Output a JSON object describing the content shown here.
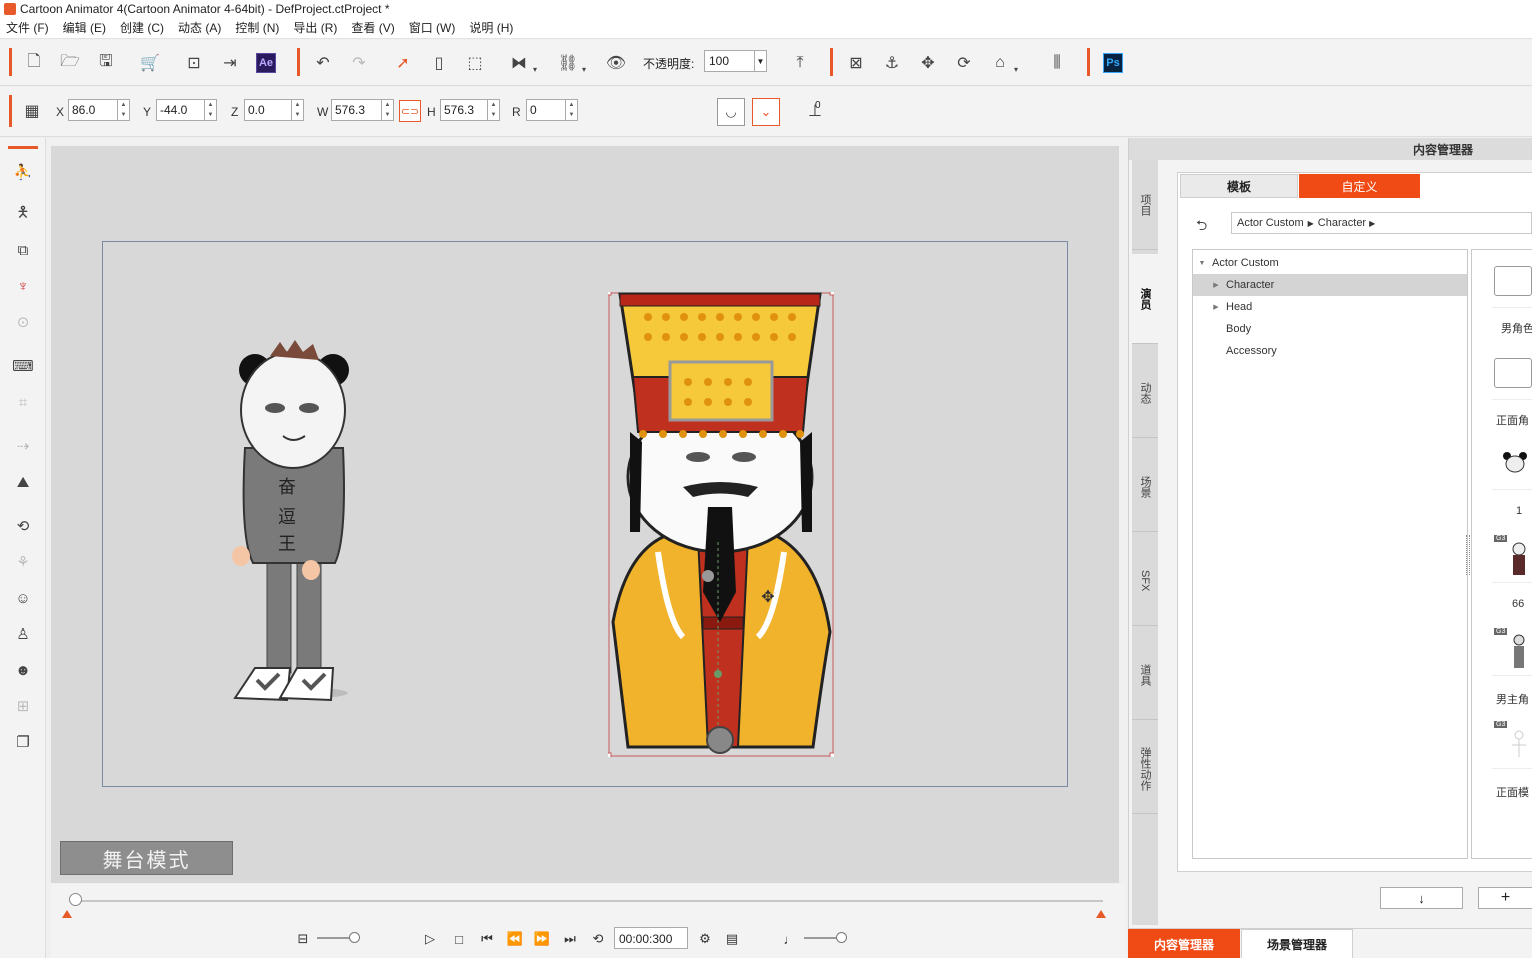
{
  "window": {
    "title": "Cartoon Animator 4(Cartoon Animator 4-64bit) - DefProject.ctProject *"
  },
  "menu": [
    "文件 (F)",
    "编辑 (E)",
    "创建 (C)",
    "动态 (A)",
    "控制 (N)",
    "导出 (R)",
    "查看 (V)",
    "窗口 (W)",
    "说明 (H)"
  ],
  "toolbar": {
    "opacity_label": "不透明度:",
    "opacity_value": "100",
    "ae_label": "Ae",
    "ps_label": "Ps"
  },
  "transform": {
    "x_label": "X",
    "x_value": "86.0",
    "y_label": "Y",
    "y_value": "-44.0",
    "z_label": "Z",
    "z_value": "0.0",
    "w_label": "W",
    "w_value": "576.3",
    "h_label": "H",
    "h_value": "576.3",
    "r_label": "R",
    "r_value": "0",
    "pivot_label": "0"
  },
  "stage": {
    "mode_badge": "舞台模式",
    "left_char_shirt": "奋\n逗\n王"
  },
  "timeline": {
    "timecode": "00:00:300"
  },
  "right_panel": {
    "header": "内容管理器",
    "vertical_tabs": [
      "项目",
      "演员",
      "动态",
      "场景",
      "SFX",
      "道具",
      "弹性动作"
    ],
    "active_vertical_tab": "演员",
    "tabs": {
      "template": "模板",
      "custom": "自定义"
    },
    "path": [
      "Actor Custom",
      "Character"
    ],
    "tree": [
      {
        "label": "Actor Custom",
        "level": 0,
        "expanded": true
      },
      {
        "label": "Character",
        "level": 1,
        "selected": true
      },
      {
        "label": "Head",
        "level": 1
      },
      {
        "label": "Body",
        "level": 1
      },
      {
        "label": "Accessory",
        "level": 1
      }
    ],
    "thumbs": [
      {
        "label": "男角色"
      },
      {
        "label": "正面角"
      },
      {
        "label": "1"
      },
      {
        "label": "66",
        "badge": "G3"
      },
      {
        "label": "男主角",
        "badge": "G3"
      },
      {
        "label": "正面模",
        "badge": "G3"
      }
    ],
    "down_button": "↓",
    "plus_button": "+",
    "bottom_tabs": {
      "content": "内容管理器",
      "scene": "场景管理器"
    }
  },
  "colors": {
    "accent": "#f04b14",
    "stage_bg": "#d8d8d8"
  }
}
